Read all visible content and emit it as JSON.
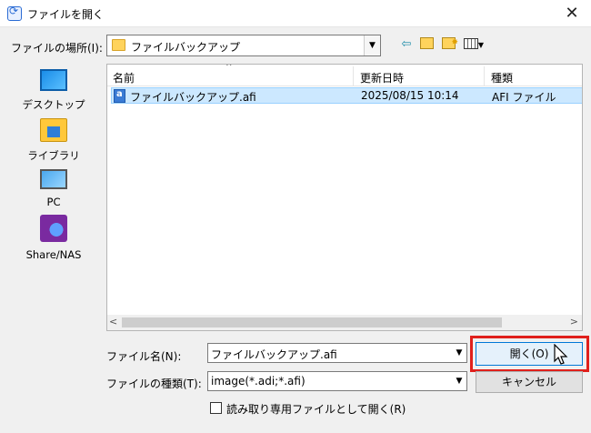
{
  "window": {
    "title": "ファイルを開く",
    "close_symbol": "✕"
  },
  "location": {
    "label": "ファイルの場所(I):",
    "value": "ファイルバックアップ"
  },
  "places": [
    {
      "label": "デスクトップ",
      "icon": "desktop-icon"
    },
    {
      "label": "ライブラリ",
      "icon": "library-icon"
    },
    {
      "label": "PC",
      "icon": "pc-icon"
    },
    {
      "label": "Share/NAS",
      "icon": "network-icon"
    }
  ],
  "file_list": {
    "columns": [
      "名前",
      "更新日時",
      "種類"
    ],
    "rows": [
      {
        "name": "ファイルバックアップ.afi",
        "modified": "2025/08/15 10:14",
        "type": "AFI ファイル",
        "selected": true
      }
    ]
  },
  "filename": {
    "label": "ファイル名(N):",
    "value": "ファイルバックアップ.afi"
  },
  "filetype": {
    "label": "ファイルの種類(T):",
    "value": "image(*.adi;*.afi)"
  },
  "buttons": {
    "open": "開く(O)",
    "cancel": "キャンセル"
  },
  "readonly": {
    "label": "読み取り専用ファイルとして開く(R)",
    "checked": false
  },
  "colors": {
    "highlight": "#e0201c",
    "selection": "#cce8ff"
  }
}
